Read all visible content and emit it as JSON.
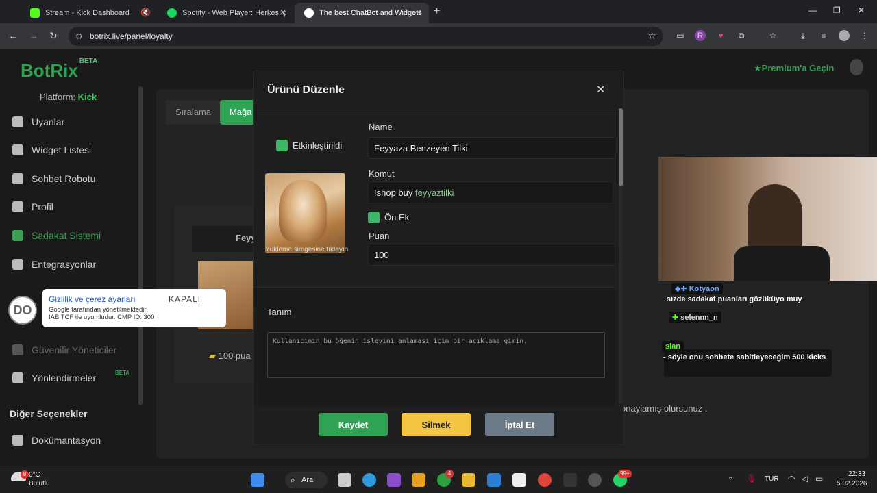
{
  "browser": {
    "tabs": [
      {
        "title": "Stream - Kick Dashboard",
        "color": "#53fc18"
      },
      {
        "title": "Spotify - Web Player: Herkes iç",
        "color": "#1ed760"
      },
      {
        "title": "The best ChatBot and Widgets",
        "color": "#ffffff"
      }
    ],
    "url": "botrix.live/panel/loyalty"
  },
  "sidebar": {
    "logo": "BotRix",
    "logo_badge": "BETA",
    "platform_label": "Platform:",
    "platform_value": "Kick",
    "items": [
      {
        "label": "Uyanlar",
        "icon": "alert-icon"
      },
      {
        "label": "Widget Listesi",
        "icon": "widget-icon"
      },
      {
        "label": "Sohbet Robotu",
        "icon": "robot-icon"
      },
      {
        "label": "Profil",
        "icon": "profile-icon"
      },
      {
        "label": "Sadakat Sistemi",
        "icon": "trophy-icon"
      },
      {
        "label": "Entegrasyonlar",
        "icon": "integration-icon"
      },
      {
        "label": "Güvenilir Yöneticiler",
        "icon": "shield-icon"
      },
      {
        "label": "Yönlendirmeler",
        "icon": "redirect-icon"
      },
      {
        "label": "Dokümantasyon",
        "icon": "docs-icon"
      }
    ],
    "beta_badge": "BETA",
    "other_section": "Diğer Seçenekler"
  },
  "header": {
    "premium": "Premium'a Geçin"
  },
  "background": {
    "tab1": "Sıralama",
    "tab2": "Mağa",
    "item_name": "Feyy",
    "item_price": "100 pua",
    "confirm_text": "onaylamış olursunuz ."
  },
  "modal": {
    "title": "Ürünü Düzenle",
    "enabled_label": "Etkinleştirildi",
    "name_label": "Name",
    "name_value": "Feyyaza Benzeyen Tilki",
    "command_label": "Komut",
    "command_prefix": "!shop buy",
    "command_value": "feyyaztilki",
    "prefix_label": "Ön Ek",
    "points_label": "Puan",
    "points_value": "100",
    "upload_caption": "Yükleme simgesine tıklayın",
    "description_label": "Tanım",
    "description_placeholder": "Kullanıcının bu öğenin işlevini anlaması için bir açıklama girin.",
    "save": "Kaydet",
    "delete": "Silmek",
    "cancel": "İptal Et"
  },
  "stream_overlay": {
    "user1": "Kotyaon",
    "msg1": "sizde sadakat puanları gözüküyo muy",
    "user2": "selennn_n",
    "user3": "slan",
    "msg3": "- söyle onu sohbete sabitleyeceğim 500 kicks"
  },
  "cookie_banner": {
    "logo_text": "DO",
    "title": "Gizlilik ve çerez ayarları",
    "status": "KAPALI",
    "line1": "Google tarafından yönetilmektedir.",
    "line2": "IAB TCF ile uyumludur. CMP ID: 300"
  },
  "taskbar": {
    "weather_temp": "0°C",
    "weather_desc": "Bulutlu",
    "weather_badge": "8",
    "search": "Ara",
    "lang": "TUR",
    "time": "22:33",
    "date": "5.02.2026",
    "xbox_badge": "4",
    "whatsapp_badge": "99+"
  }
}
